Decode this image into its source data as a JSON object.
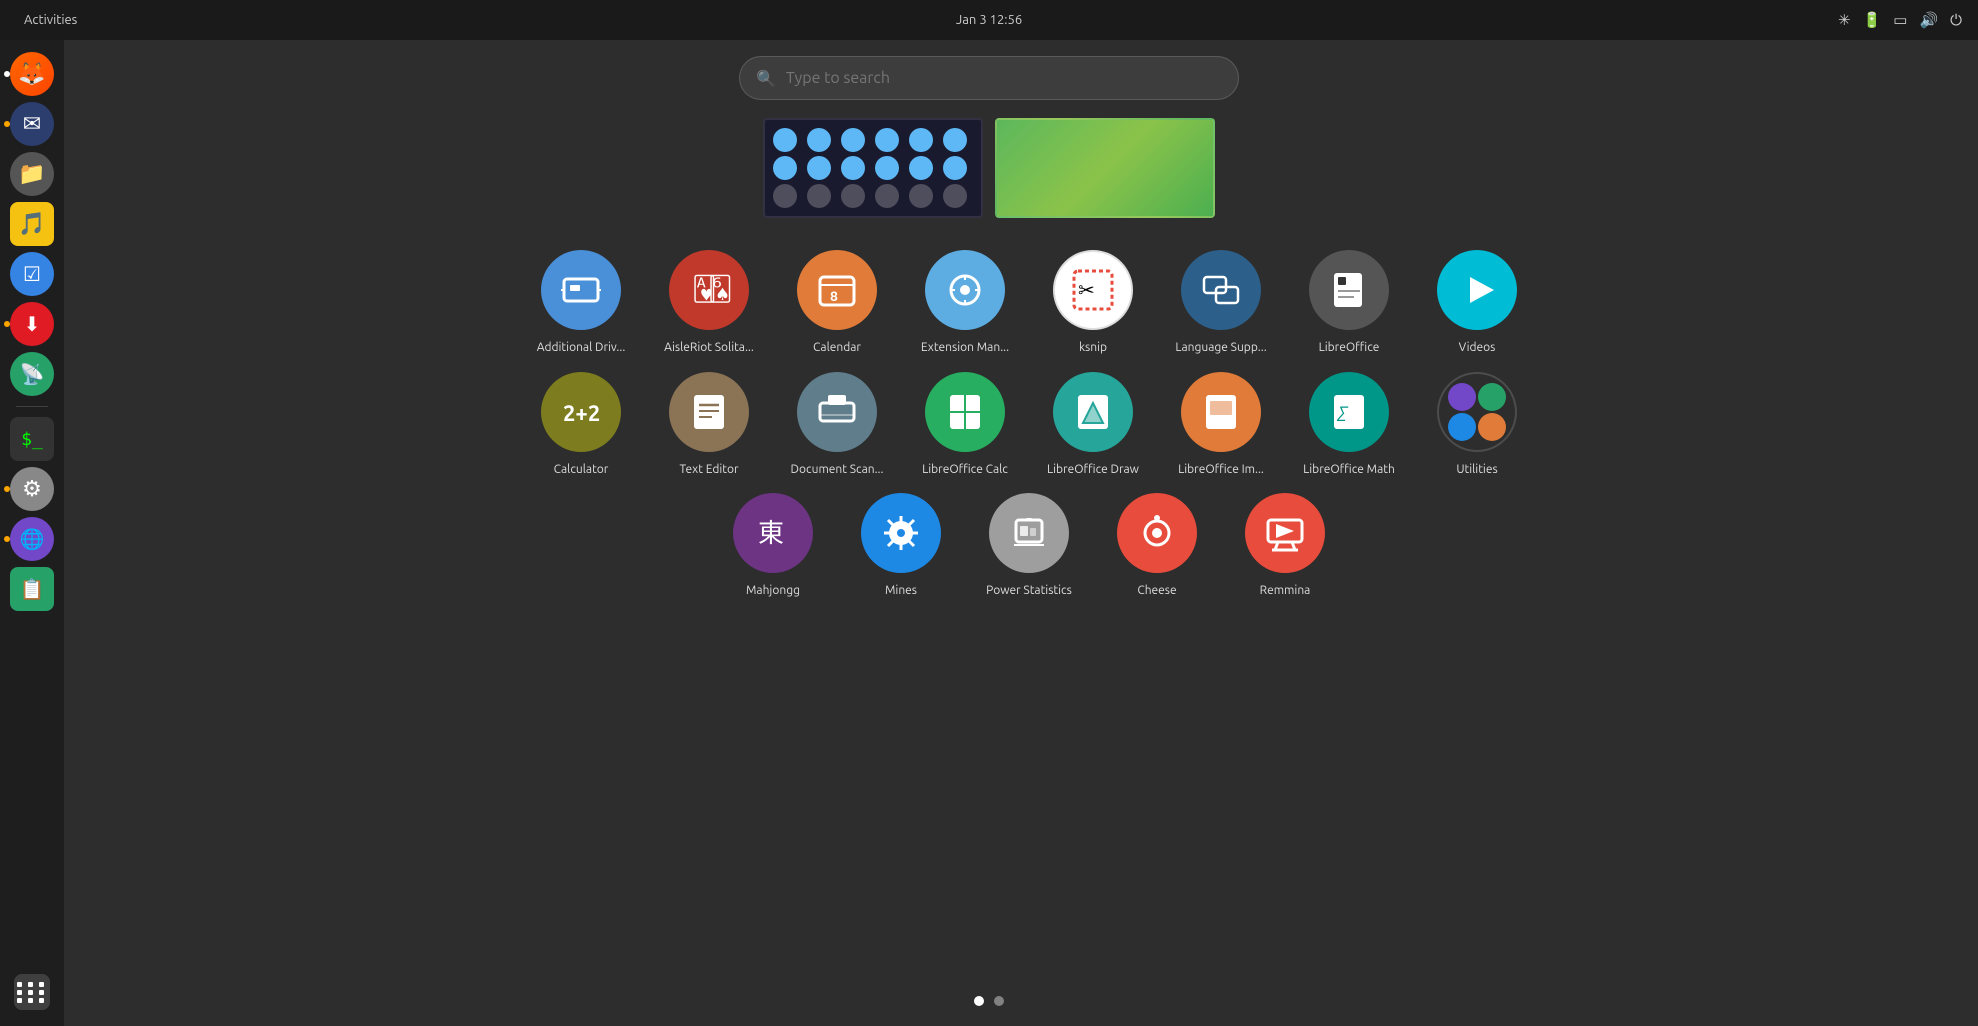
{
  "topbar": {
    "activities": "Activities",
    "datetime": "Jan 3  12:56"
  },
  "search": {
    "placeholder": "Type to search"
  },
  "dock": {
    "items": [
      {
        "name": "Firefox",
        "color": "#e66000",
        "dot": true
      },
      {
        "name": "Thunderbird",
        "color": "#0a84ff",
        "dot": true
      },
      {
        "name": "Files",
        "color": "#555"
      },
      {
        "name": "Rhythmbox",
        "color": "#f5c211"
      },
      {
        "name": "GNOME To Do",
        "color": "#3584e4"
      },
      {
        "name": "Downloads",
        "color": "#e01b24",
        "dot": true
      },
      {
        "name": "Casts",
        "color": "#26a269"
      },
      {
        "name": "Terminal",
        "color": "#444"
      },
      {
        "name": "Settings",
        "color": "#aaa",
        "dot": true
      },
      {
        "name": "Connections",
        "color": "#7248c8",
        "dot": true
      },
      {
        "name": "Clipboard",
        "color": "#26a269"
      }
    ]
  },
  "app_rows": [
    [
      {
        "label": "Additional Driv...",
        "color": "#4a90d9",
        "icon": "gpu"
      },
      {
        "label": "AisleRiot Solita...",
        "color": "#c0392b",
        "icon": "cards"
      },
      {
        "label": "Calendar",
        "color": "#e07b39",
        "icon": "calendar"
      },
      {
        "label": "Extension Man...",
        "color": "#5dade2",
        "icon": "puzzle"
      },
      {
        "label": "ksnip",
        "color": "#f0f0f0",
        "icon": "ksnip"
      },
      {
        "label": "Language Supp...",
        "color": "#2c5f8a",
        "icon": "lang"
      },
      {
        "label": "LibreOffice",
        "color": "#555",
        "icon": "libreoffice"
      },
      {
        "label": "Videos",
        "color": "#00bcd4",
        "icon": "play"
      }
    ],
    [
      {
        "label": "Calculator",
        "color": "#7d7c1e",
        "icon": "calc"
      },
      {
        "label": "Text Editor",
        "color": "#8b7355",
        "icon": "editor"
      },
      {
        "label": "Document Scan...",
        "color": "#607d8b",
        "icon": "scan"
      },
      {
        "label": "LibreOffice Calc",
        "color": "#27ae60",
        "icon": "calc2"
      },
      {
        "label": "LibreOffice Draw",
        "color": "#26a69a",
        "icon": "draw"
      },
      {
        "label": "LibreOffice Im...",
        "color": "#e07b39",
        "icon": "impress"
      },
      {
        "label": "LibreOffice Math",
        "color": "#009688",
        "icon": "math"
      },
      {
        "label": "Utilities",
        "color": "multi",
        "icon": "utilities"
      }
    ],
    [
      {
        "label": "Mahjongg",
        "color": "#6c3483",
        "icon": "mahjong"
      },
      {
        "label": "Mines",
        "color": "#1e88e5",
        "icon": "mines"
      },
      {
        "label": "Power Statistics",
        "color": "#9e9e9e",
        "icon": "battery"
      },
      {
        "label": "Cheese",
        "color": "#e74c3c",
        "icon": "webcam"
      },
      {
        "label": "Remmina",
        "color": "#e74c3c",
        "icon": "remmina"
      }
    ]
  ],
  "page_dots": [
    {
      "active": true
    },
    {
      "active": false
    }
  ]
}
